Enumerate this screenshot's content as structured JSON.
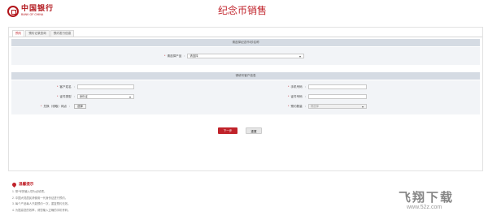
{
  "header": {
    "logo_cn": "中国银行",
    "logo_en": "BANK OF CHINA",
    "title": "纪念币销售"
  },
  "tabs": [
    {
      "label": "预约",
      "active": true
    },
    {
      "label": "预约记录查询",
      "active": false
    },
    {
      "label": "预约发行信息",
      "active": false
    }
  ],
  "section1": {
    "title": "请选择纪念币/钞名称",
    "product_label": "请选择产品",
    "product_value": "请选择"
  },
  "section2": {
    "title": "请填写客户信息",
    "name_label": "客户姓名",
    "name_value": "",
    "phone_label": "手机号码",
    "phone_value": "",
    "id_type_label": "证件类型",
    "id_type_value": "身份证",
    "id_no_label": "证件号码",
    "id_no_value": "",
    "branch_label": "兑换（领取）网点",
    "branch_button": "选择",
    "qty_label": "预约数量",
    "qty_value": "请选择"
  },
  "actions": {
    "next": "下一步",
    "reset": "重置"
  },
  "tips": {
    "title": "温馨提示",
    "items": [
      "1. 带*号的输入项为必填项。",
      "2. 中国大陆居民请使用一代身份证进行预约。",
      "3. 每个产品每人只能预约一次，重复预约无效。",
      "4. 为提高您的效率，请您输入正确的手机号码。"
    ]
  },
  "watermark": {
    "text": "飞翔下载",
    "url": "www.52z.com"
  },
  "colors": {
    "brand_red": "#c0222a",
    "section_bar": "#d5dbe3",
    "section_bg": "#f2f4f7"
  }
}
